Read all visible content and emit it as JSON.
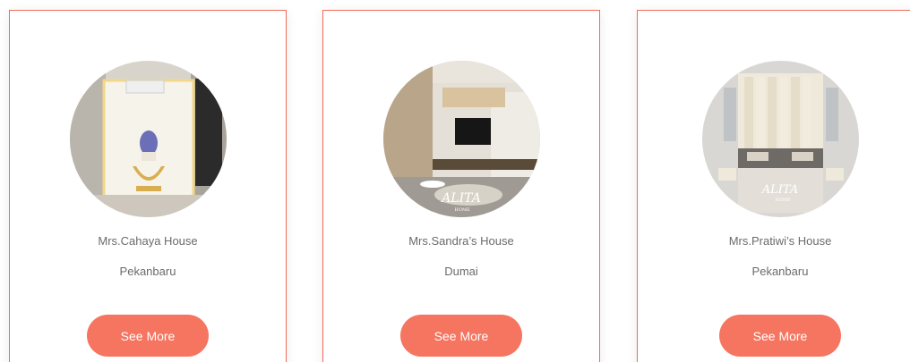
{
  "colors": {
    "accent": "#f57560",
    "card_border": "#f26b57",
    "text": "#6b6b6b"
  },
  "projects": [
    {
      "name": "Mrs.Cahaya House",
      "city": "Pekanbaru",
      "button_label": "See More"
    },
    {
      "name": "Mrs.Sandra’s House",
      "city": "Dumai",
      "button_label": "See More"
    },
    {
      "name": "Mrs.Pratiwi’s House",
      "city": "Pekanbaru",
      "button_label": "See More"
    }
  ]
}
